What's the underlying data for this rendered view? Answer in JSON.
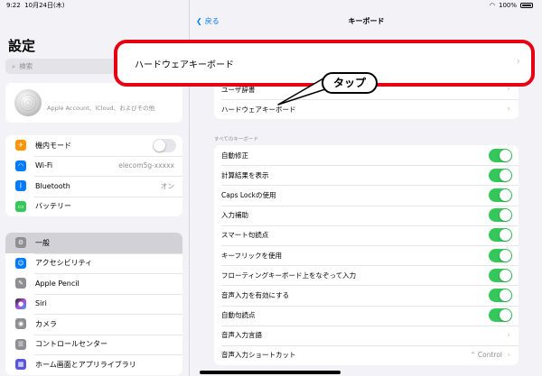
{
  "status": {
    "time": "9:22",
    "date": "10月24日(木)",
    "battery": "100%"
  },
  "sidebar": {
    "title": "設定",
    "search_placeholder": "検索",
    "account_text": "Apple Account、iCloud、およびその他",
    "group1": [
      {
        "label": "機内モード",
        "icon": "airplane-icon",
        "color": "#ff9500"
      },
      {
        "label": "Wi-Fi",
        "icon": "wifi-icon",
        "color": "#007aff",
        "value": "elecom5g-xxxxx"
      },
      {
        "label": "Bluetooth",
        "icon": "bluetooth-icon",
        "color": "#007aff",
        "value": "オン"
      },
      {
        "label": "バッテリー",
        "icon": "battery-icon",
        "color": "#34c759"
      }
    ],
    "group2": [
      {
        "label": "一般",
        "icon": "gear-icon",
        "color": "#8e8e93"
      },
      {
        "label": "アクセシビリティ",
        "icon": "accessibility-icon",
        "color": "#007aff"
      },
      {
        "label": "Apple Pencil",
        "icon": "pencil-icon",
        "color": "#8e8e93"
      },
      {
        "label": "Siri",
        "icon": "siri-icon",
        "color": "#222222"
      },
      {
        "label": "カメラ",
        "icon": "camera-icon",
        "color": "#8e8e93"
      },
      {
        "label": "コントロールセンター",
        "icon": "control-center-icon",
        "color": "#8e8e93"
      },
      {
        "label": "ホーム画面とアプリライブラリ",
        "icon": "home-screen-icon",
        "color": "#5856d6"
      }
    ]
  },
  "main": {
    "back_label": "戻る",
    "title": "キーボード",
    "highlight_label": "ハードウェアキーボード",
    "callout": "タップ",
    "top_group": [
      "ユーザ辞書",
      "ハードウェアキーボード"
    ],
    "section_label": "すべてのキーボード",
    "settings": [
      {
        "label": "自動修正"
      },
      {
        "label": "計算結果を表示"
      },
      {
        "label": "Caps Lockの使用"
      },
      {
        "label": "入力補助"
      },
      {
        "label": "スマート句読点"
      },
      {
        "label": "キーフリックを使用"
      },
      {
        "label": "フローティングキーボード上をなぞって入力"
      },
      {
        "label": "音声入力を有効にする"
      },
      {
        "label": "自動句読点"
      }
    ],
    "bottom_group": [
      {
        "label": "音声入力言語"
      },
      {
        "label": "音声入力ショートカット",
        "value": "Control"
      }
    ]
  },
  "colors": {
    "accent": "#007aff",
    "toggle_on": "#34c759",
    "highlight": "#e60012"
  }
}
